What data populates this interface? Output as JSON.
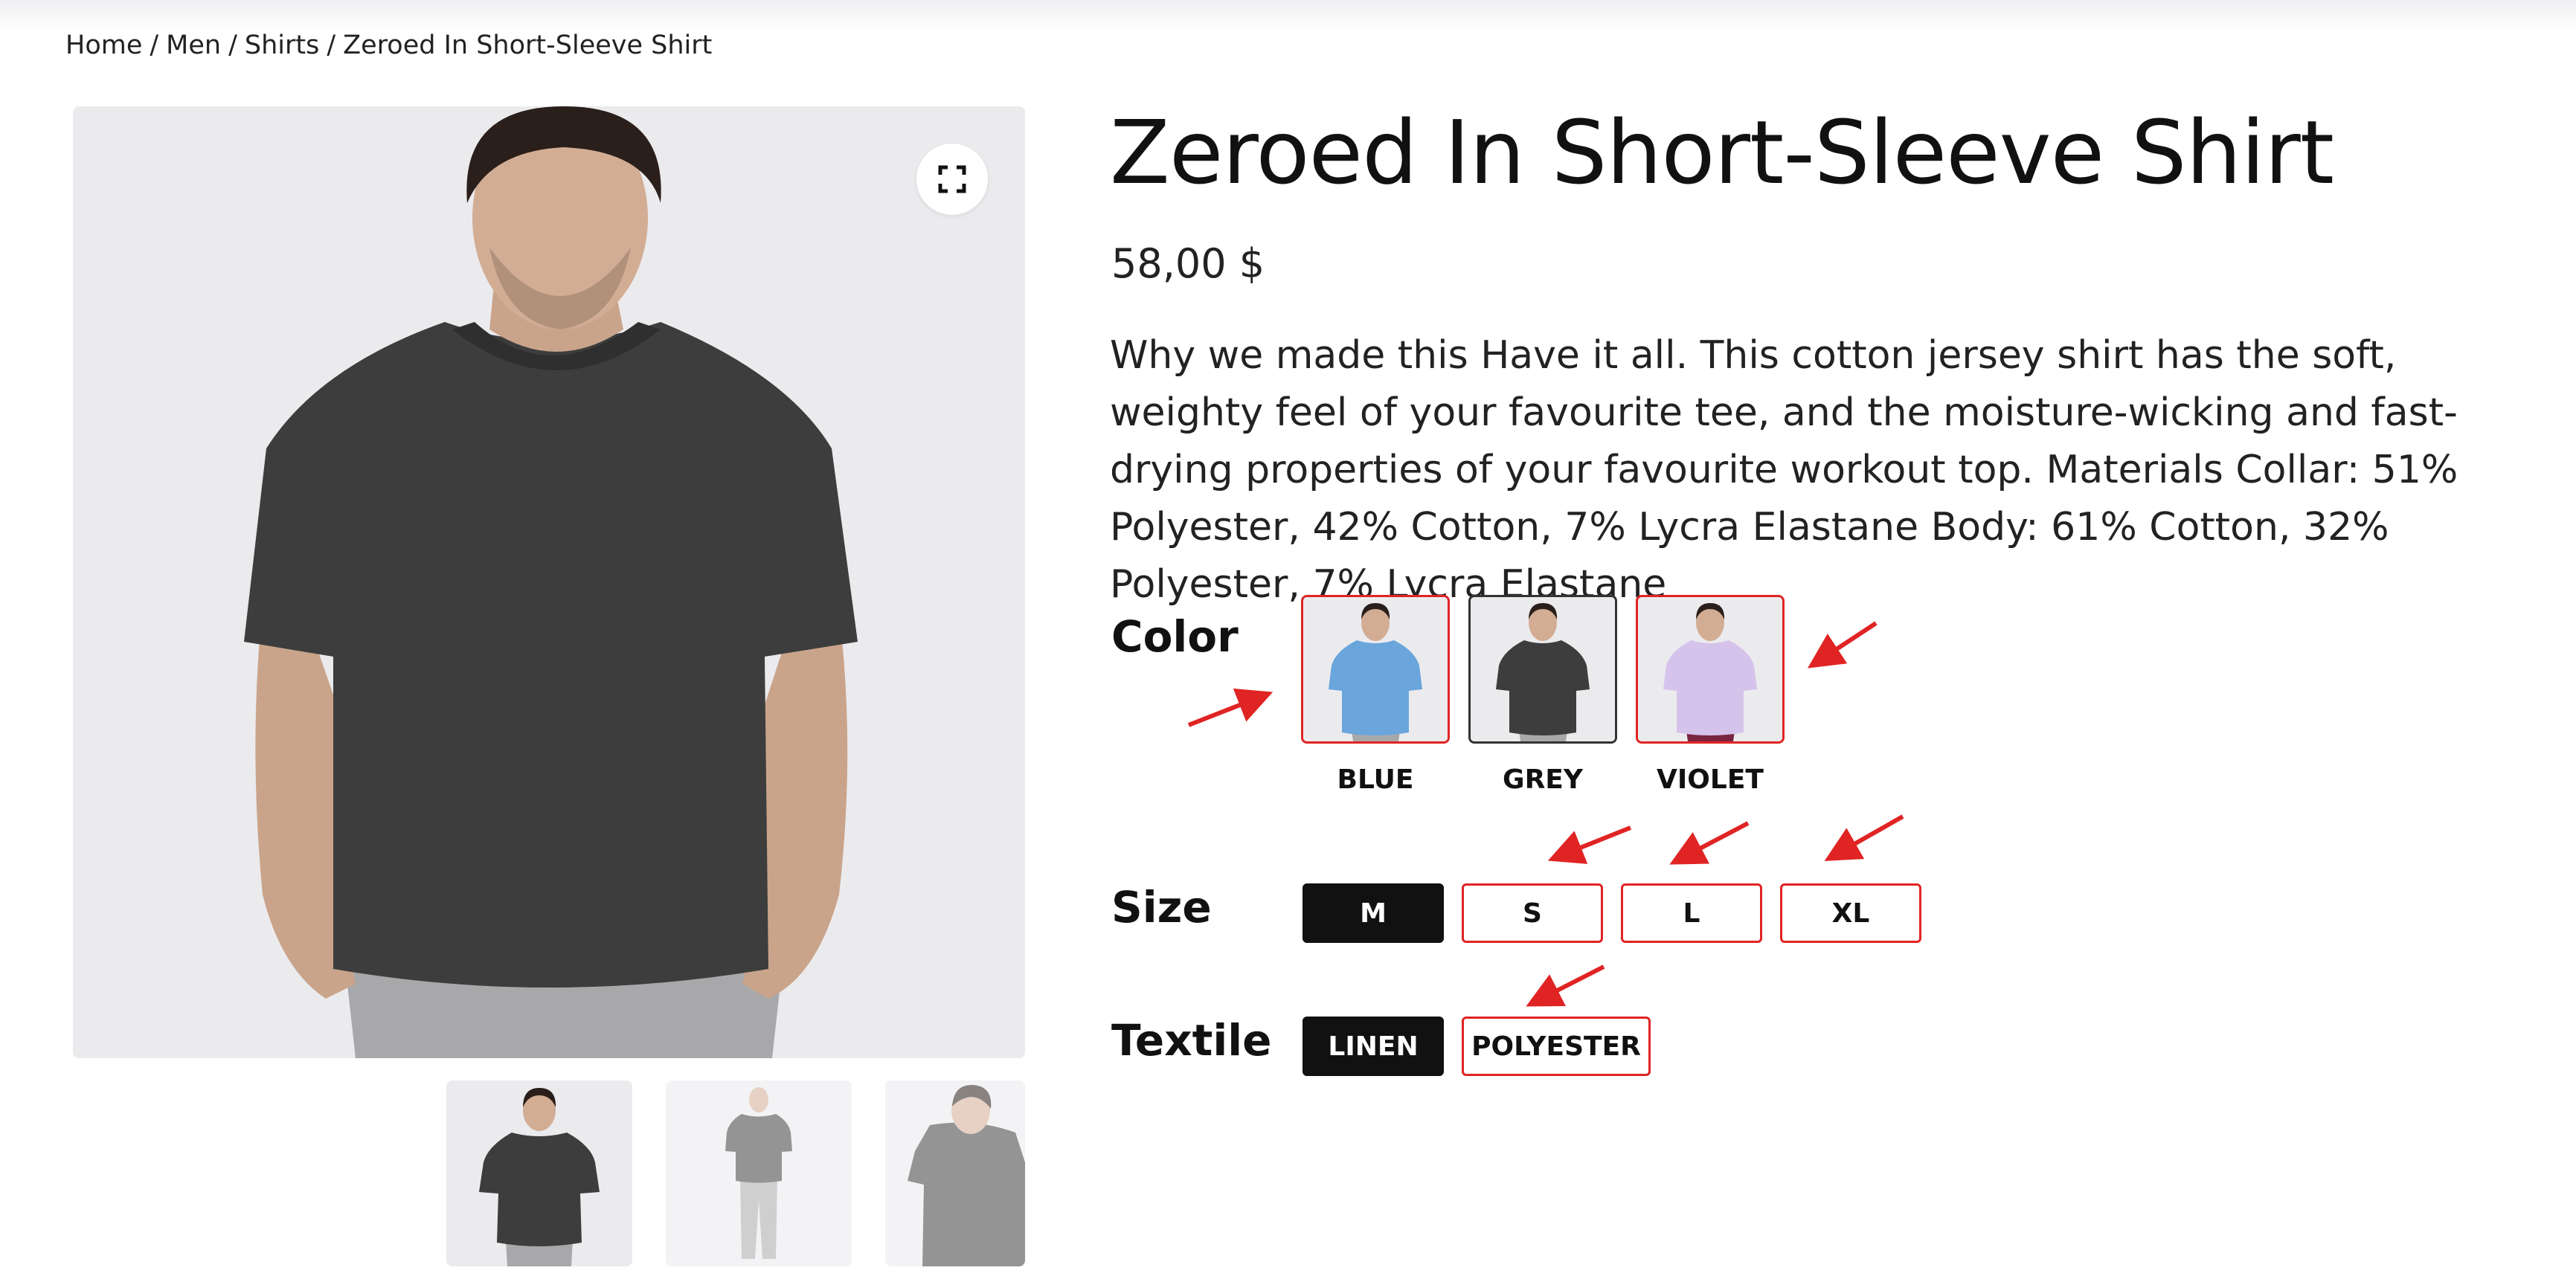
{
  "breadcrumb": {
    "items": [
      "Home",
      "Men",
      "Shirts",
      "Zeroed In Short-Sleeve Shirt"
    ],
    "separator": "/"
  },
  "gallery": {
    "main_image": "model-grey-shirt-front",
    "thumbnails": [
      "model-grey-shirt-front",
      "model-grey-shirt-full-body",
      "model-grey-shirt-back"
    ],
    "expand_icon": "fullscreen-icon"
  },
  "product": {
    "title": "Zeroed In Short-Sleeve Shirt",
    "price": "58,00 $",
    "description": "Why we made this Have it all. This cotton jersey shirt has the soft, weighty feel of your favourite tee, and the moisture-wicking and fast-drying properties of your favourite workout top. Materials Collar: 51% Polyester, 42% Cotton, 7% Lycra Elastane Body: 61% Cotton, 32% Polyester, 7% Lycra Elastane"
  },
  "options": {
    "color": {
      "label": "Color",
      "swatches": [
        {
          "label": "BLUE",
          "color": "#6aa5dc"
        },
        {
          "label": "GREY",
          "color": "#3c3d3c"
        },
        {
          "label": "VIOLET",
          "color": "#d6c3ec"
        }
      ],
      "selected": "GREY"
    },
    "size": {
      "label": "Size",
      "values": [
        "M",
        "S",
        "L",
        "XL"
      ],
      "selected": "M"
    },
    "textile": {
      "label": "Textile",
      "values": [
        "LINEN",
        "POLYESTER"
      ],
      "selected": "LINEN"
    }
  },
  "colors": {
    "accent_red": "#e02424",
    "selected_chip": "#111111",
    "image_background": "#ebebee"
  }
}
